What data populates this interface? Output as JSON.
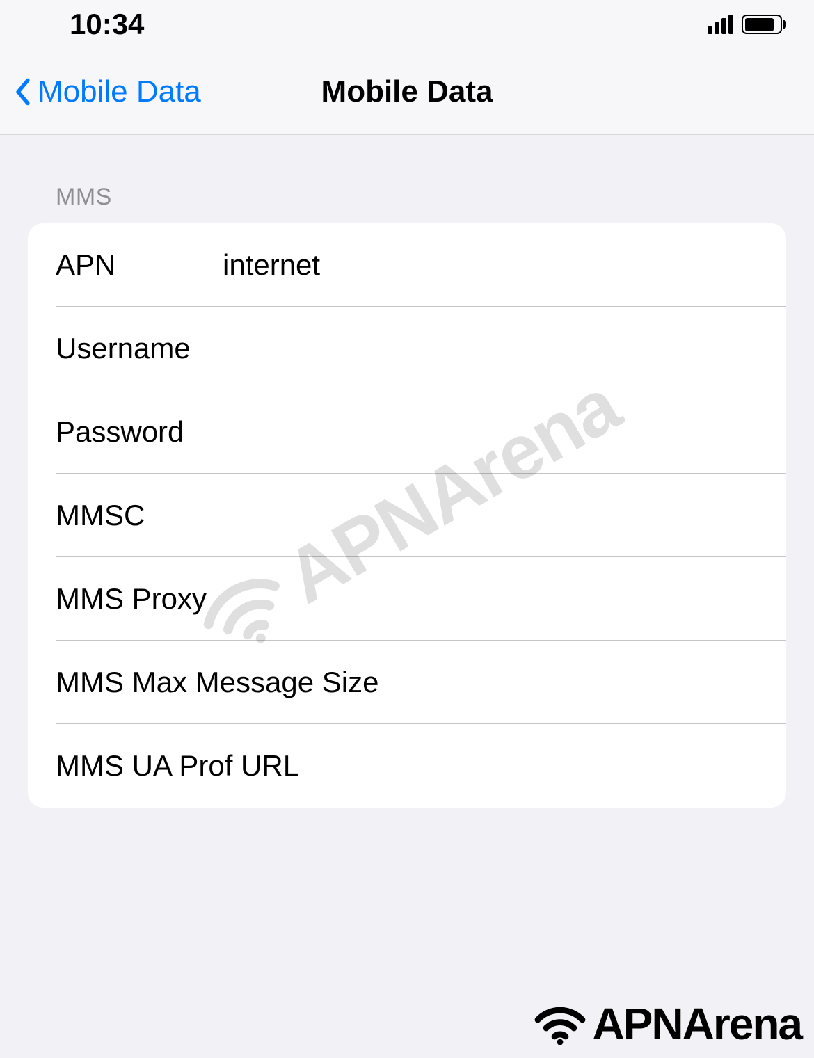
{
  "status_bar": {
    "time": "10:34"
  },
  "nav": {
    "back_label": "Mobile Data",
    "title": "Mobile Data"
  },
  "section": {
    "header": "MMS",
    "rows": [
      {
        "label": "APN",
        "value": "internet"
      },
      {
        "label": "Username",
        "value": ""
      },
      {
        "label": "Password",
        "value": ""
      },
      {
        "label": "MMSC",
        "value": ""
      },
      {
        "label": "MMS Proxy",
        "value": ""
      },
      {
        "label": "MMS Max Message Size",
        "value": ""
      },
      {
        "label": "MMS UA Prof URL",
        "value": ""
      }
    ]
  },
  "watermark": {
    "text": "APNArena"
  },
  "footer": {
    "brand": "APNArena"
  }
}
